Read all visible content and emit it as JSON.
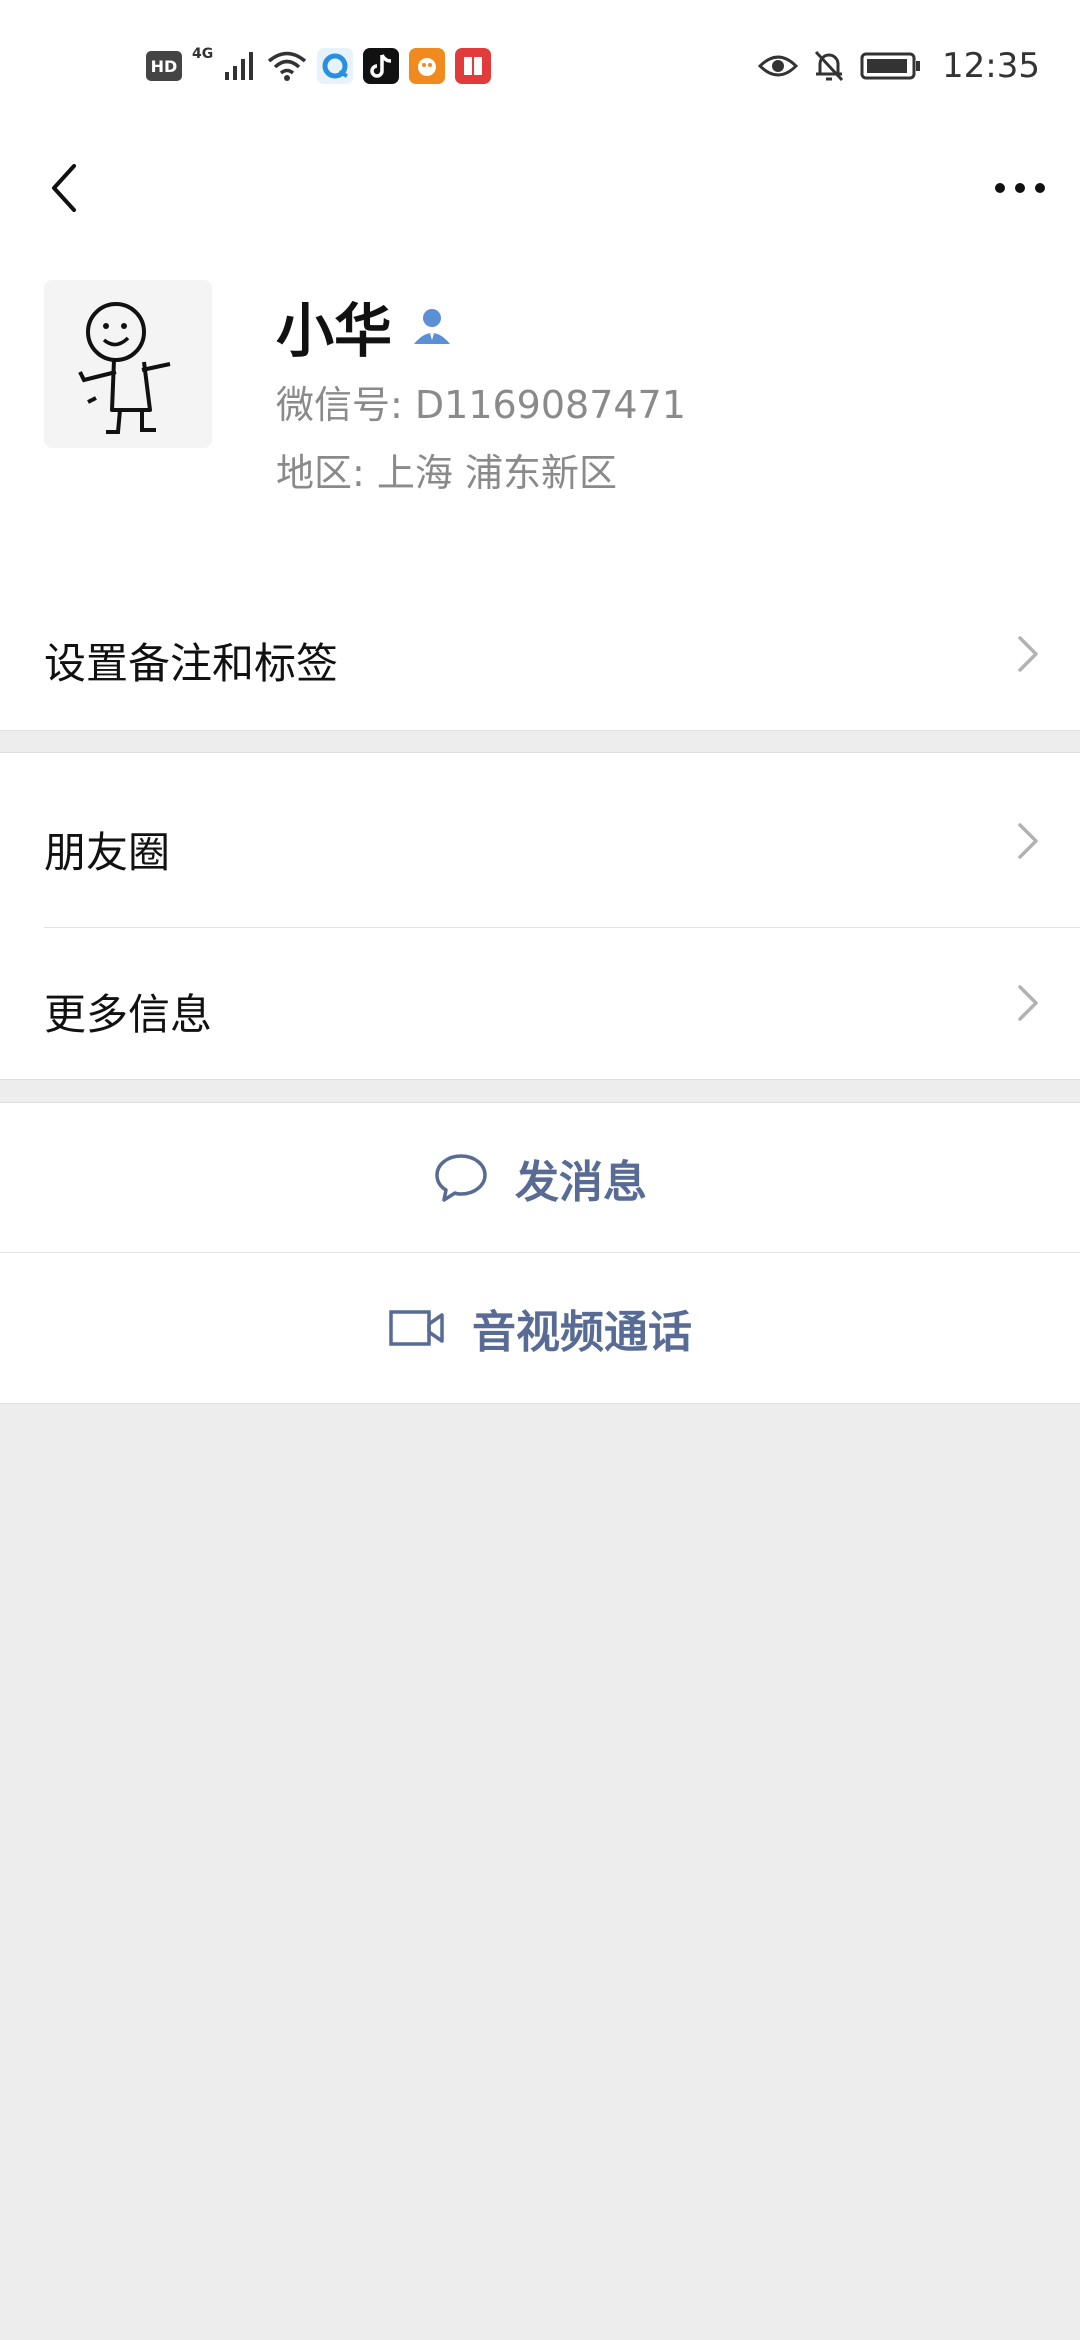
{
  "status_bar": {
    "hd_badge": "HD",
    "network": "4G",
    "time": "12:35",
    "icons_left": [
      "hd-icon",
      "signal-icon",
      "wifi-icon",
      "browser-app-icon",
      "tiktok-app-icon",
      "game-app-icon",
      "reader-app-icon"
    ],
    "icons_right": [
      "eye-icon",
      "bell-muted-icon",
      "battery-icon"
    ]
  },
  "nav": {
    "back_icon": "chevron-left-icon",
    "more_icon": "ellipsis-icon"
  },
  "profile": {
    "name": "小华",
    "wechat_id": "微信号: D1169087471",
    "region": "地区: 上海  浦东新区",
    "name_badge_icon": "contact-person-icon"
  },
  "cells": {
    "remark_label": "设置备注和标签",
    "moments_label": "朋友圈",
    "more_info_label": "更多信息"
  },
  "actions": {
    "send_message_label": "发消息",
    "av_call_label": "音视频通话"
  },
  "colors": {
    "accent_link": "#576b95",
    "page_bg": "#ededed",
    "secondary_text": "#8a8a8a",
    "badge_blue": "#5b8fd6"
  }
}
